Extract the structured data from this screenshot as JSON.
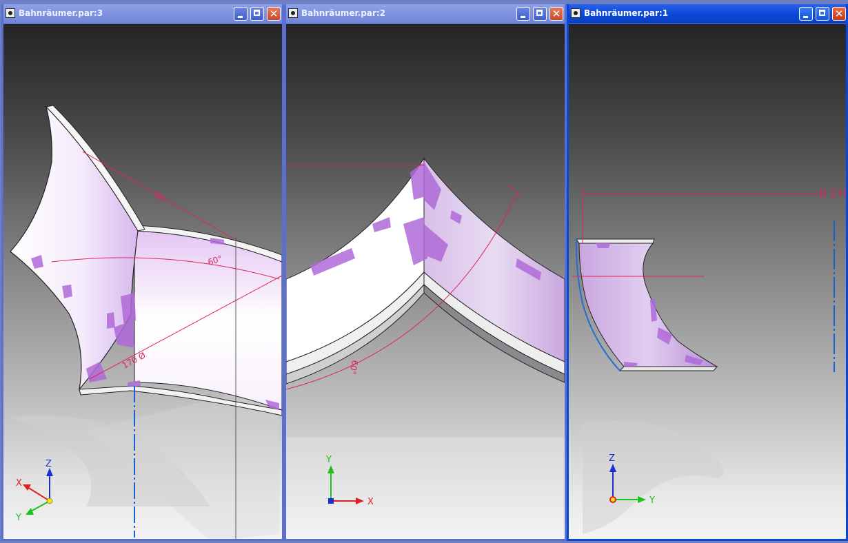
{
  "windows": [
    {
      "title": "Bahnräumer.par:3",
      "active": false,
      "dimensions": {
        "radius": "60",
        "angle": "60°",
        "diameter": "170 Ø"
      },
      "triad": {
        "x": "X",
        "y": "Y",
        "z": "Z"
      }
    },
    {
      "title": "Bahnräumer.par:2",
      "active": false,
      "dimensions": {
        "angle": "60°"
      },
      "triad": {
        "x": "X",
        "y": "Y"
      }
    },
    {
      "title": "Bahnräumer.par:1",
      "active": true,
      "dimensions": {
        "diameter": "Ø 170"
      },
      "triad": {
        "y": "Y",
        "z": "Z"
      }
    }
  ],
  "colors": {
    "dimension": "#e0245a",
    "axis_x": "#e02020",
    "axis_y": "#19c419",
    "axis_z": "#1a2fd0",
    "surface_purple": "#b06ad8",
    "titlebar_active": "#0a47d6",
    "titlebar_inactive": "#7c90de"
  },
  "icons": {
    "window": "document-icon",
    "minimize": "minimize-icon",
    "maximize": "maximize-icon",
    "close": "close-icon"
  }
}
